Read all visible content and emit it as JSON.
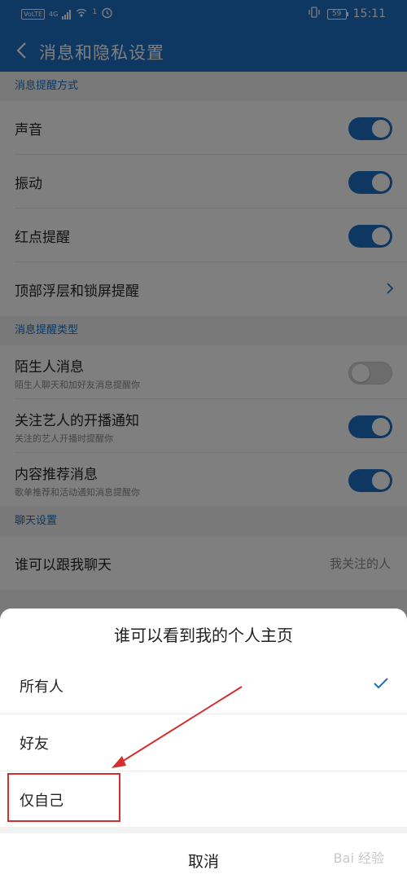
{
  "status_bar": {
    "volte": "VoLTE",
    "network": "4G",
    "notif_count": "1",
    "battery": "59",
    "time": "15:11"
  },
  "app_bar": {
    "title": "消息和隐私设置"
  },
  "sections": [
    {
      "header": "消息提醒方式",
      "rows": [
        {
          "title": "声音",
          "toggle": true
        },
        {
          "title": "振动",
          "toggle": true
        },
        {
          "title": "红点提醒",
          "toggle": true
        },
        {
          "title": "顶部浮层和锁屏提醒",
          "chevron": true
        }
      ]
    },
    {
      "header": "消息提醒类型",
      "rows": [
        {
          "title": "陌生人消息",
          "subtitle": "陌生人聊天和加好友消息提醒你",
          "toggle": false
        },
        {
          "title": "关注艺人的开播通知",
          "subtitle": "关注的艺人开播时提醒你",
          "toggle": true
        },
        {
          "title": "内容推荐消息",
          "subtitle": "歌单推荐和活动通知消息提醒你",
          "toggle": true
        }
      ]
    },
    {
      "header": "聊天设置",
      "rows": [
        {
          "title": "谁可以跟我聊天",
          "value": "我关注的人"
        }
      ]
    }
  ],
  "sheet": {
    "title": "谁可以看到我的个人主页",
    "options": [
      {
        "label": "所有人",
        "selected": true
      },
      {
        "label": "好友",
        "selected": false
      },
      {
        "label": "仅自己",
        "selected": false
      }
    ],
    "cancel": "取消"
  },
  "watermark": "Bai 经验",
  "colors": {
    "primary": "#1c6fc2",
    "annotation": "#d32f2f"
  }
}
